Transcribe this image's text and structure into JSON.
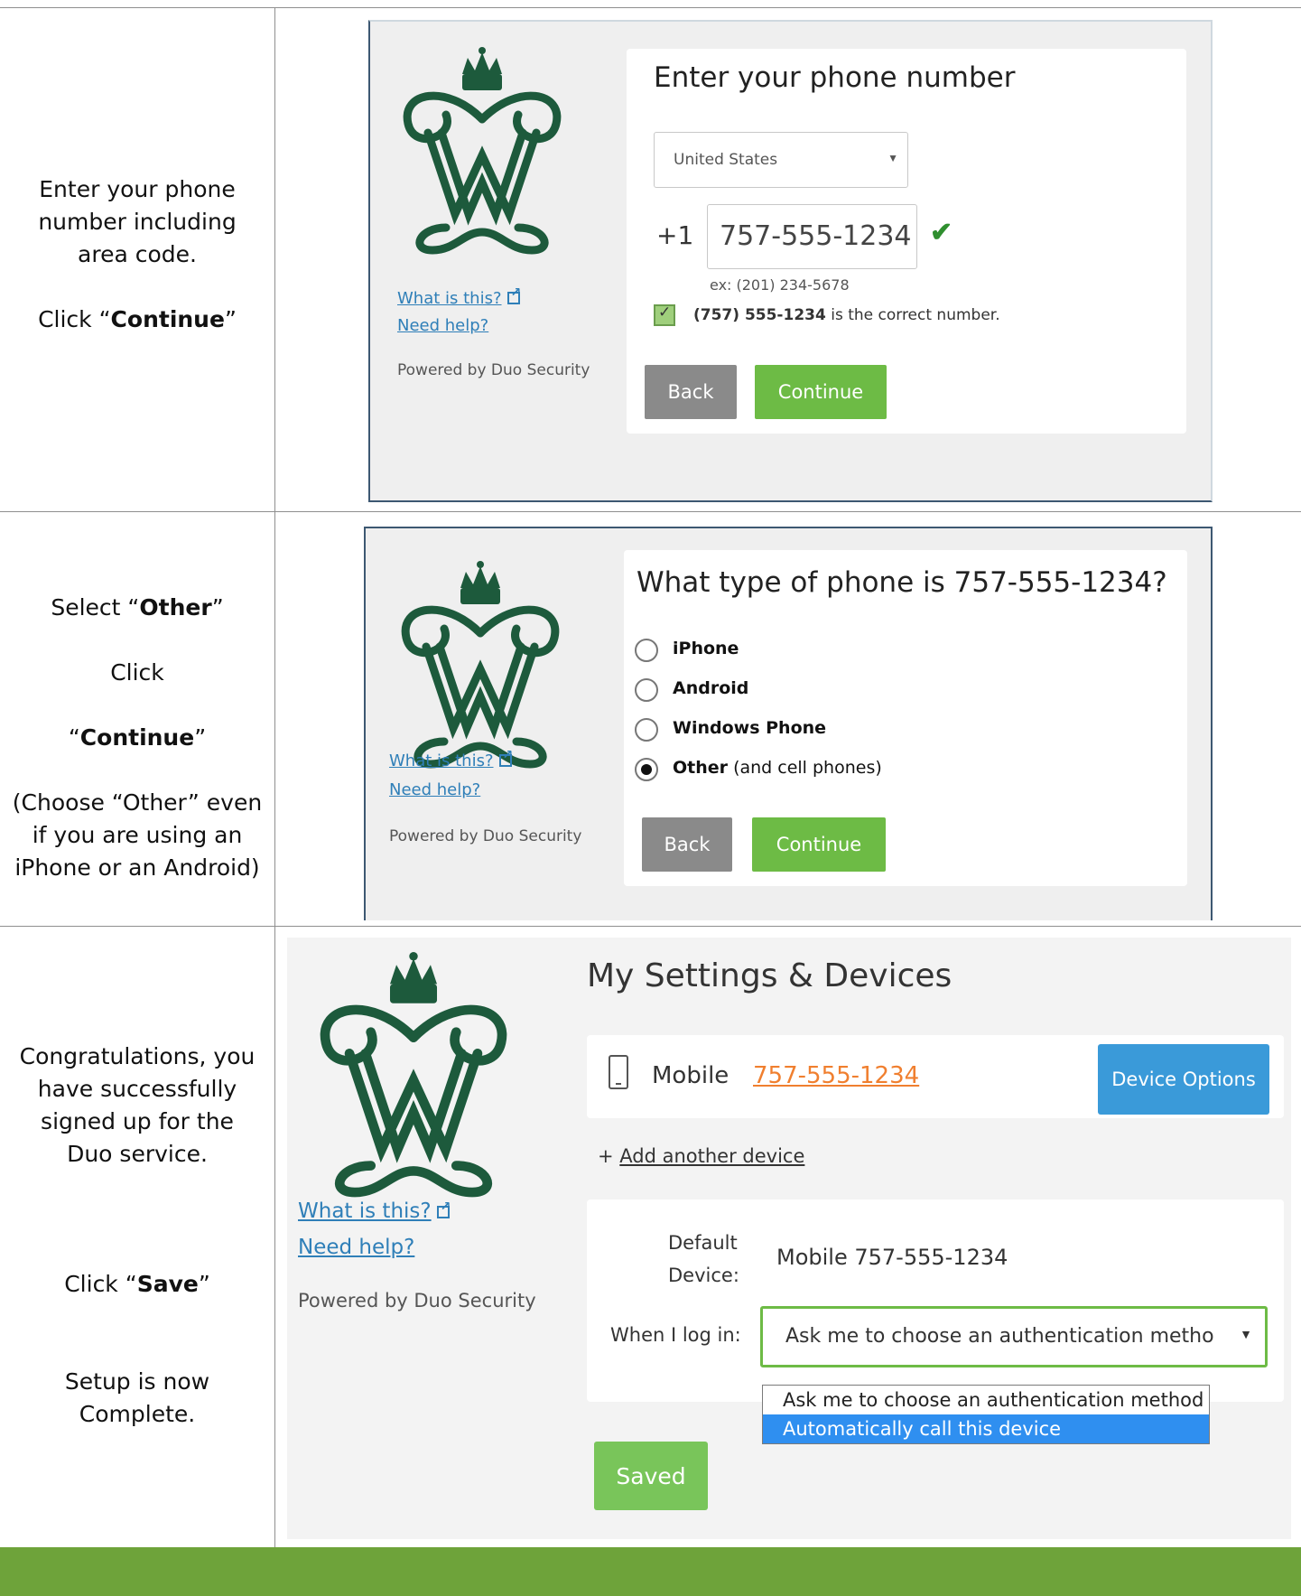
{
  "steps": [
    {
      "instructions": {
        "line1": "Enter your phone number including area code.",
        "line2_prefix": "Click “",
        "line2_bold": "Continue",
        "line2_suffix": "”"
      },
      "panel": {
        "title": "Enter your phone number",
        "country_select": "United States",
        "country_code": "+1",
        "phone_value": "757-555-1234",
        "phone_example": "ex: (201) 234-5678",
        "confirm_bold": "(757) 555-1234",
        "confirm_text": " is the correct number.",
        "back_label": "Back",
        "continue_label": "Continue",
        "what_is_this": "What is this?",
        "need_help": "Need help?",
        "powered_by": "Powered by Duo Security"
      }
    },
    {
      "instructions": {
        "line1_prefix": "Select “",
        "line1_bold": "Other",
        "line1_suffix": "”",
        "line2": "Click",
        "line3_prefix": "“",
        "line3_bold": "Continue",
        "line3_suffix": "”",
        "line4": "(Choose “Other” even if you are using an iPhone or an Android)"
      },
      "panel": {
        "title": "What type of phone is 757-555-1234?",
        "options": [
          {
            "bold": "iPhone",
            "extra": "",
            "selected": false
          },
          {
            "bold": "Android",
            "extra": "",
            "selected": false
          },
          {
            "bold": "Windows Phone",
            "extra": "",
            "selected": false
          },
          {
            "bold": "Other",
            "extra": " (and cell phones)",
            "selected": true
          }
        ],
        "back_label": "Back",
        "continue_label": "Continue",
        "what_is_this": "What is this?",
        "need_help": "Need help?",
        "powered_by": "Powered by Duo Security"
      }
    },
    {
      "instructions": {
        "line1": "Congratulations, you have successfully signed up for the Duo service.",
        "line2_prefix": "Click “",
        "line2_bold": "Save",
        "line2_suffix": "”",
        "line3": "Setup is now Complete."
      },
      "panel": {
        "title": "My Settings & Devices",
        "device_type": "Mobile",
        "device_number": "757-555-1234",
        "device_options_label": "Device Options",
        "add_device_prefix": "+ ",
        "add_device_label": "Add another device",
        "default_device_label": "Default Device:",
        "default_device_value": "Mobile 757-555-1234",
        "when_login_label": "When I log in:",
        "select_value": "Ask me to choose an authentication metho",
        "dropdown_options": [
          "Ask me to choose an authentication method",
          "Automatically call this device"
        ],
        "saved_label": "Saved",
        "what_is_this": "What is this?",
        "need_help": "Need help?",
        "powered_by": "Powered by Duo Security"
      }
    }
  ],
  "colors": {
    "green_button": "#6dbb45",
    "grey_button": "#8a8a8a",
    "link_blue": "#2f7fb8",
    "device_blue": "#3a9ad9",
    "footer_green": "#6ea33a",
    "dropdown_highlight": "#2f8ff0",
    "logo_green": "#1d5a3c"
  }
}
